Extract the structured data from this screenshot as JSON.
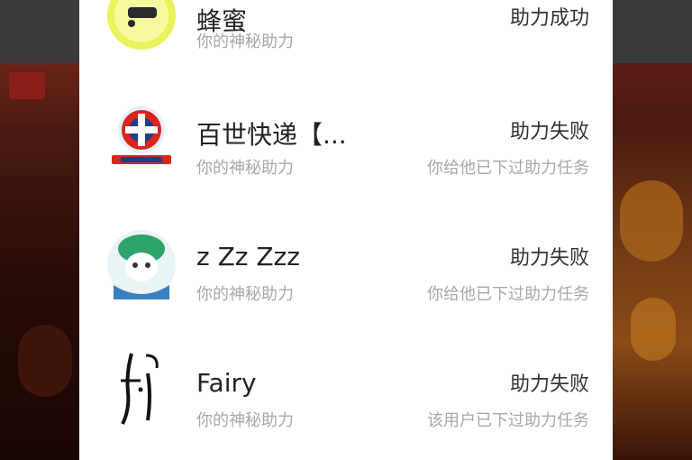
{
  "list": {
    "items": [
      {
        "name": "蜂蜜",
        "sub": "你的神秘助力",
        "status": "助力成功",
        "note": "",
        "avatar_icon": "yellow-smiley-avatar-icon"
      },
      {
        "name": "百世快递【...",
        "sub": "你的神秘助力",
        "status": "助力失败",
        "note": "你给他已下过助力任务",
        "avatar_icon": "best-express-logo-icon"
      },
      {
        "name": "z Zz Zzz",
        "sub": "你的神秘助力",
        "status": "助力失败",
        "note": "你给他已下过助力任务",
        "avatar_icon": "green-cartoon-avatar-icon"
      },
      {
        "name": "Fairy",
        "sub": "你的神秘助力",
        "status": "助力失败",
        "note": "该用户已下过助力任务",
        "avatar_icon": "handwriting-f-avatar-icon"
      }
    ]
  },
  "colors": {
    "name_text": "#222222",
    "secondary_text": "#a8a8a8",
    "sheet_bg": "#ffffff"
  }
}
